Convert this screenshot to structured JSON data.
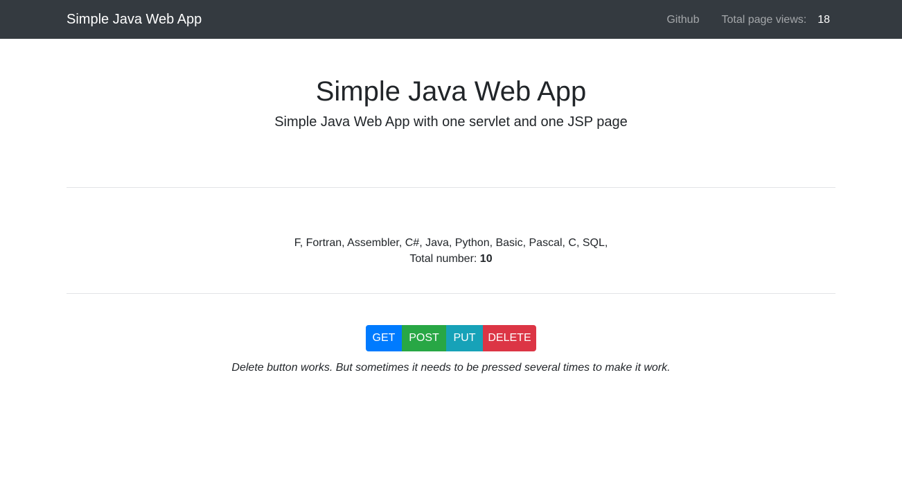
{
  "navbar": {
    "brand": "Simple Java Web App",
    "github_link": "Github",
    "views_label": "Total page views:",
    "views_count": "18"
  },
  "jumbotron": {
    "title": "Simple Java Web App",
    "subtitle": "Simple Java Web App with one servlet and one JSP page"
  },
  "content": {
    "languages": "F, Fortran, Assembler, C#, Java, Python, Basic, Pascal, C, SQL,",
    "total_label": "Total number:",
    "total_value": "10"
  },
  "actions": {
    "get_label": "GET",
    "post_label": "POST",
    "put_label": "PUT",
    "delete_label": "DELETE",
    "note": "Delete button works. But sometimes it needs to be pressed several times to make it work."
  },
  "colors": {
    "navbar_bg": "#343a40",
    "get": "#007bff",
    "post": "#28a745",
    "put": "#17a2b8",
    "delete": "#dc3545"
  }
}
